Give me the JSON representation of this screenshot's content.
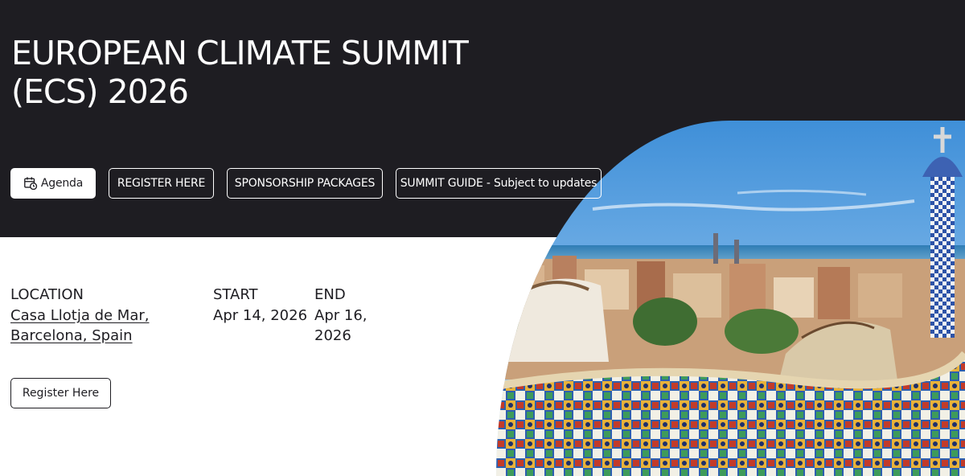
{
  "header": {
    "title_line1": "EUROPEAN CLIMATE SUMMIT",
    "title_line2": "(ECS) 2026"
  },
  "actions": {
    "agenda_label": "Agenda",
    "register_label": "REGISTER HERE",
    "sponsorship_label": "SPONSORSHIP PACKAGES",
    "guide_label": "SUMMIT GUIDE - Subject to updates"
  },
  "details": {
    "location_label": "LOCATION",
    "location_line1": "Casa Llotja de Mar,",
    "location_line2": "Barcelona, Spain",
    "start_label": "START",
    "start_value": "Apr 14, 2026",
    "end_label": "END",
    "end_value_line1": "Apr 16,",
    "end_value_line2": "2026"
  },
  "cta": {
    "register_label": "Register Here"
  },
  "icons": {
    "agenda": "calendar-clock-icon"
  },
  "colors": {
    "dark_band": "#1e1d22",
    "text": "#1e1d22",
    "button_outline": "#ffffff"
  }
}
